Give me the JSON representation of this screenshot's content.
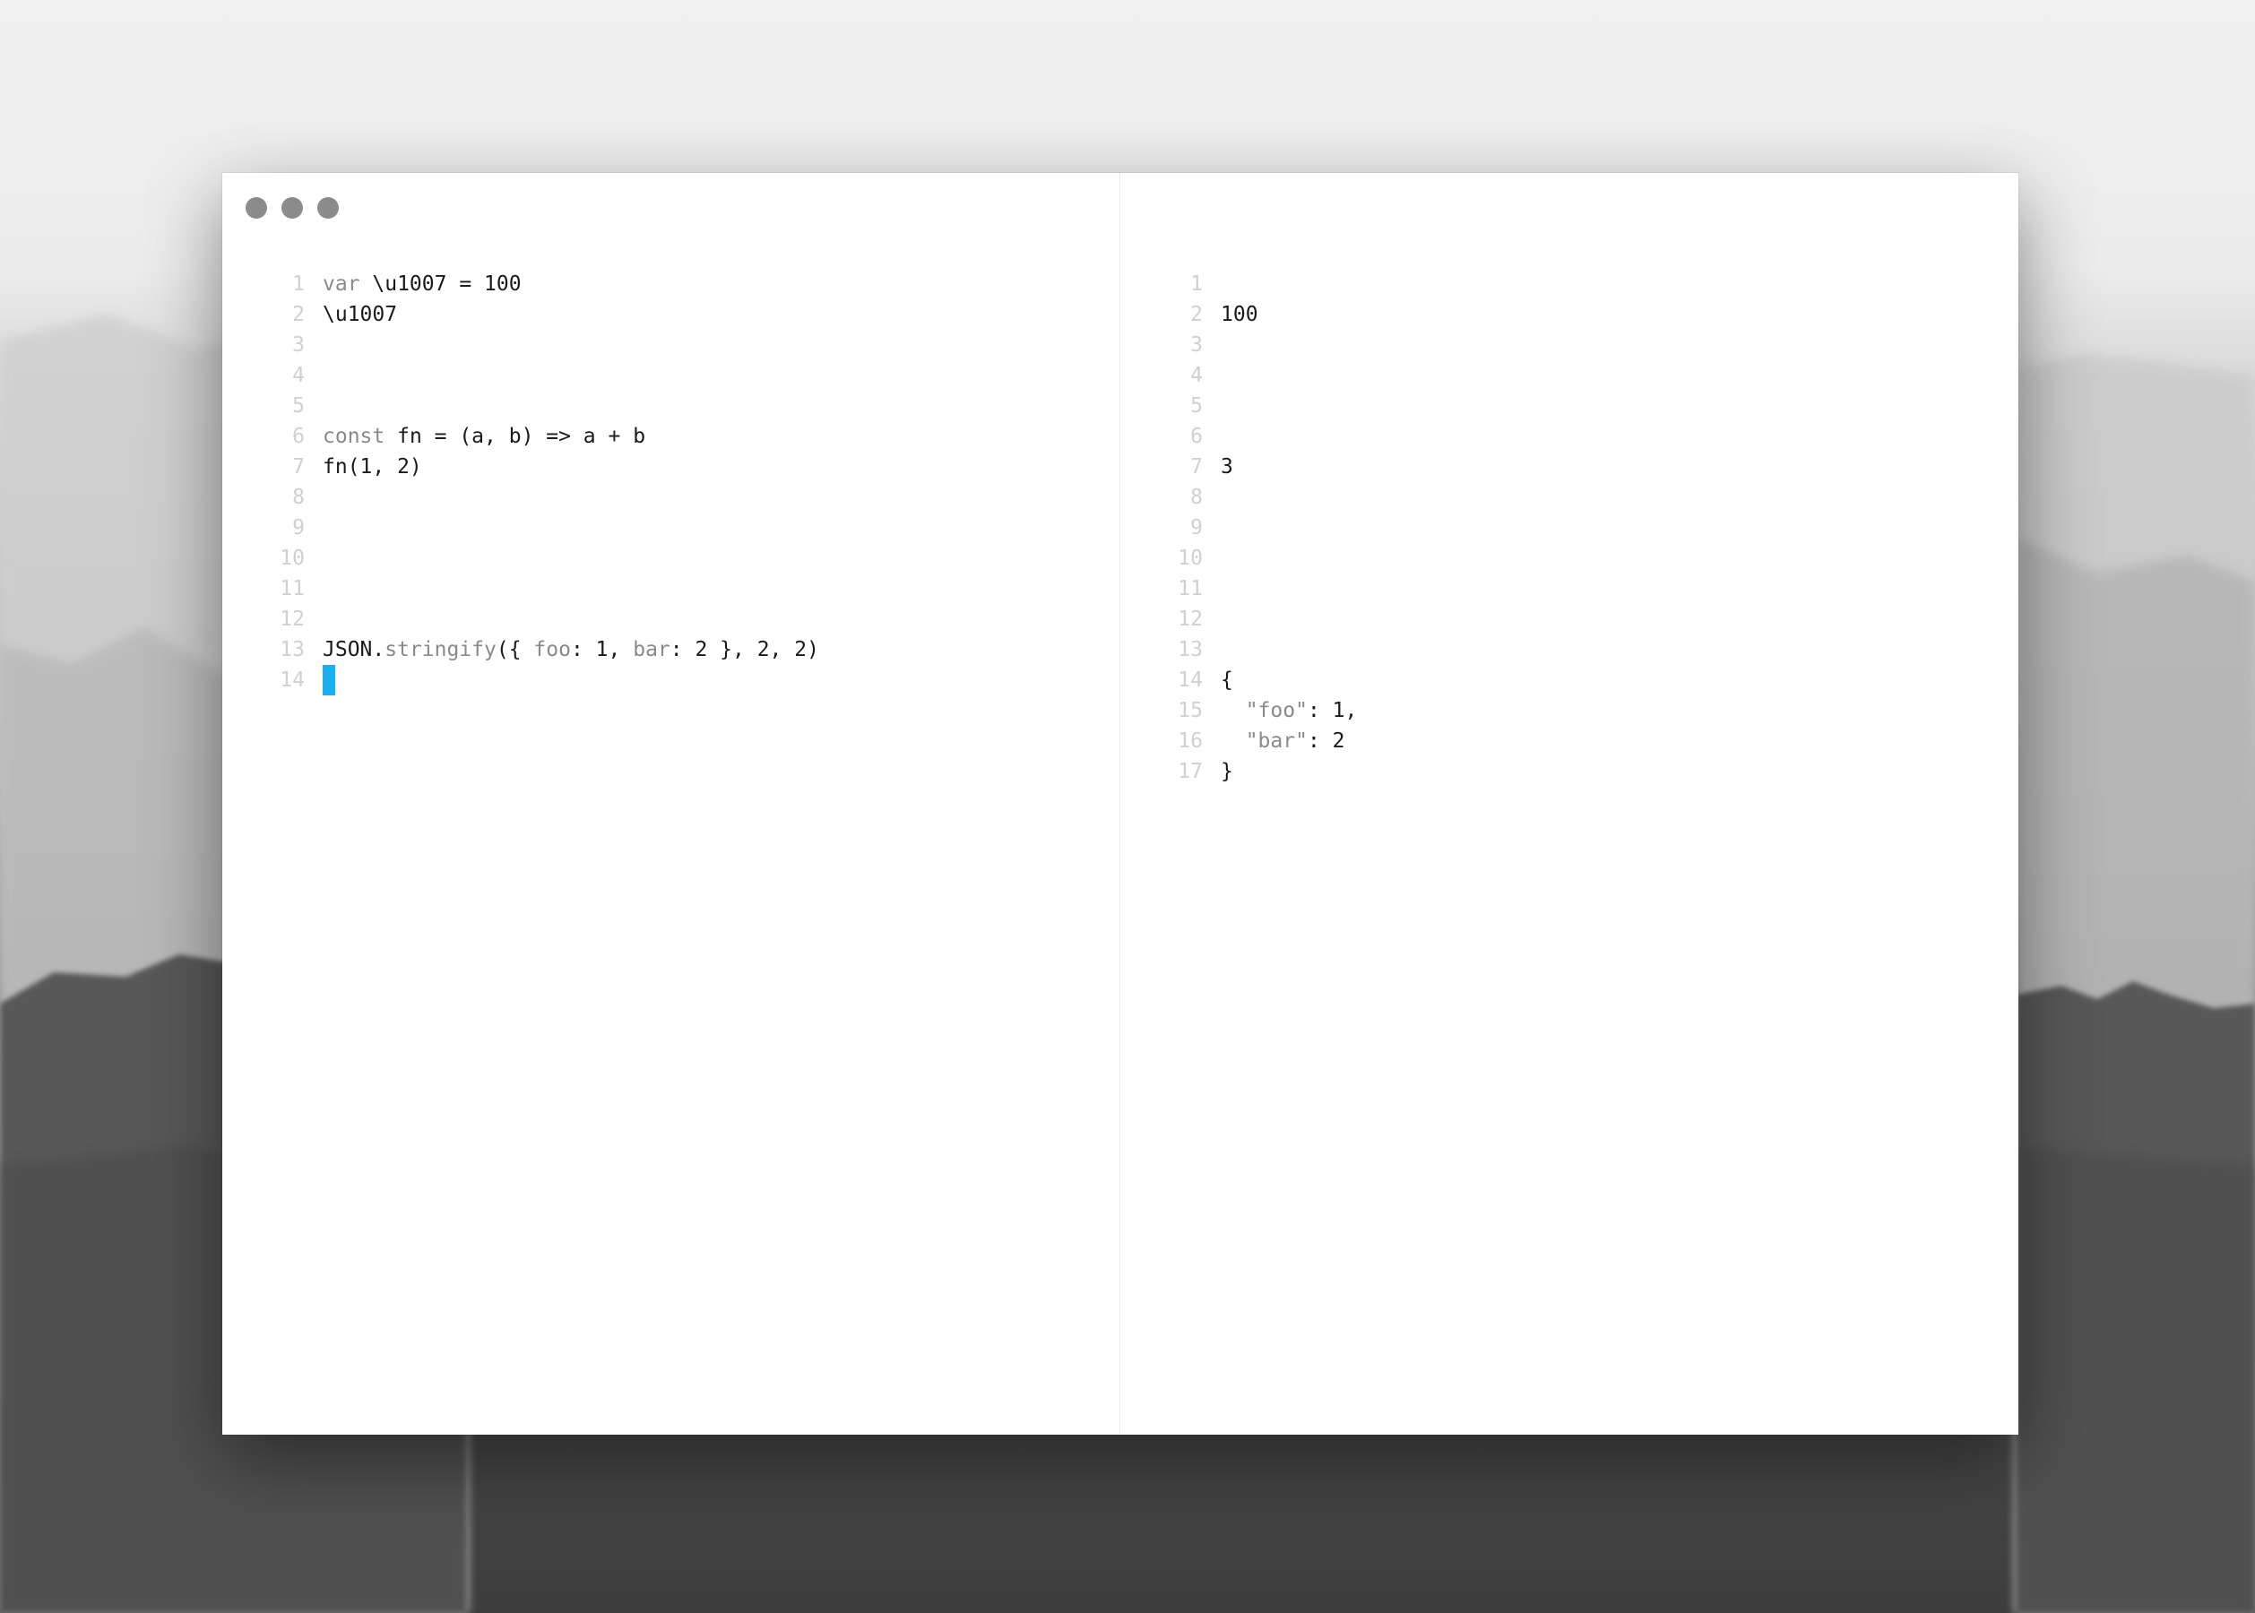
{
  "background": {
    "colors": [
      "#f1f1f1",
      "#3d3d3d"
    ]
  },
  "window": {
    "traffic_lights": [
      "close-dot",
      "minimize-dot",
      "zoom-dot"
    ],
    "cursor_color": "#1ab0f0"
  },
  "editor": {
    "lines": [
      {
        "n": "1",
        "parts": [
          [
            "var ",
            "muted"
          ],
          [
            "\\u1007 = 100",
            ""
          ]
        ]
      },
      {
        "n": "2",
        "parts": [
          [
            "\\u1007",
            ""
          ]
        ]
      },
      {
        "n": "3",
        "parts": []
      },
      {
        "n": "4",
        "parts": []
      },
      {
        "n": "5",
        "parts": []
      },
      {
        "n": "6",
        "parts": [
          [
            "const ",
            "muted"
          ],
          [
            "fn = (a, b) => a + b",
            ""
          ]
        ]
      },
      {
        "n": "7",
        "parts": [
          [
            "fn(1, 2)",
            ""
          ]
        ]
      },
      {
        "n": "8",
        "parts": []
      },
      {
        "n": "9",
        "parts": []
      },
      {
        "n": "10",
        "parts": []
      },
      {
        "n": "11",
        "parts": []
      },
      {
        "n": "12",
        "parts": []
      },
      {
        "n": "13",
        "parts": [
          [
            "JSON.",
            ""
          ],
          [
            "stringify",
            "muted"
          ],
          [
            "({ ",
            ""
          ],
          [
            "foo",
            "muted"
          ],
          [
            ": 1, ",
            ""
          ],
          [
            "bar",
            "muted"
          ],
          [
            ": 2 }, 2, 2)",
            ""
          ]
        ]
      },
      {
        "n": "14",
        "parts": [],
        "cursor": true
      }
    ]
  },
  "output": {
    "lines": [
      {
        "n": "1",
        "parts": []
      },
      {
        "n": "2",
        "parts": [
          [
            "100",
            ""
          ]
        ]
      },
      {
        "n": "3",
        "parts": []
      },
      {
        "n": "4",
        "parts": []
      },
      {
        "n": "5",
        "parts": []
      },
      {
        "n": "6",
        "parts": []
      },
      {
        "n": "7",
        "parts": [
          [
            "3",
            ""
          ]
        ]
      },
      {
        "n": "8",
        "parts": []
      },
      {
        "n": "9",
        "parts": []
      },
      {
        "n": "10",
        "parts": []
      },
      {
        "n": "11",
        "parts": []
      },
      {
        "n": "12",
        "parts": []
      },
      {
        "n": "13",
        "parts": []
      },
      {
        "n": "14",
        "parts": [
          [
            "{",
            ""
          ]
        ]
      },
      {
        "n": "15",
        "parts": [
          [
            "  ",
            ""
          ],
          [
            "\"foo\"",
            "muted"
          ],
          [
            ": 1,",
            ""
          ]
        ]
      },
      {
        "n": "16",
        "parts": [
          [
            "  ",
            ""
          ],
          [
            "\"bar\"",
            "muted"
          ],
          [
            ": 2",
            ""
          ]
        ]
      },
      {
        "n": "17",
        "parts": [
          [
            "}",
            ""
          ]
        ]
      }
    ]
  }
}
